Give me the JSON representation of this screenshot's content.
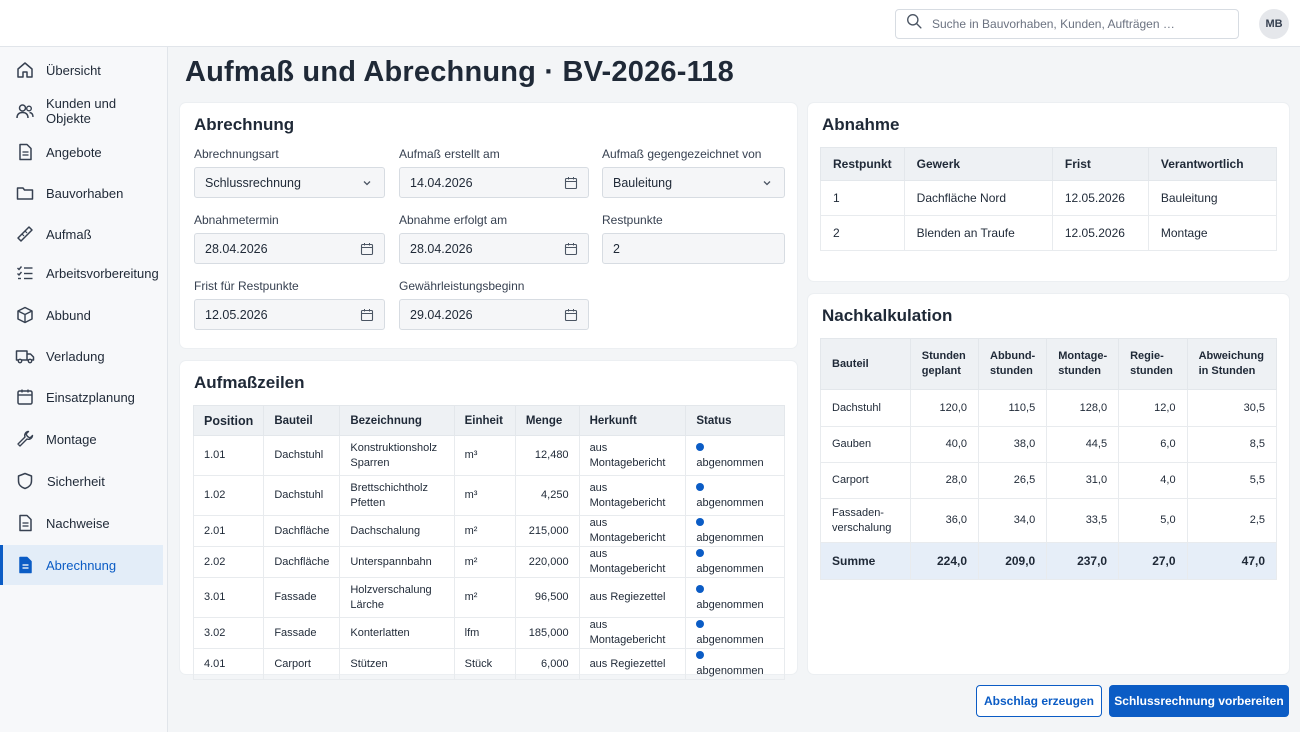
{
  "header": {
    "search_placeholder": "Suche in Bauvorhaben, Kunden, Aufträgen …",
    "user_initials": "MB"
  },
  "sidebar": {
    "items": [
      {
        "label": "Übersicht",
        "icon": "home-icon"
      },
      {
        "label": "Kunden und Objekte",
        "icon": "users-icon"
      },
      {
        "label": "Angebote",
        "icon": "document-icon"
      },
      {
        "label": "Bauvorhaben",
        "icon": "folder-icon"
      },
      {
        "label": "Aufmaß",
        "icon": "ruler-icon"
      },
      {
        "label": "Arbeitsvorbereitung",
        "icon": "checklist-icon"
      },
      {
        "label": "Abbund",
        "icon": "box-icon"
      },
      {
        "label": "Verladung",
        "icon": "truck-icon"
      },
      {
        "label": "Einsatzplanung",
        "icon": "calendar-icon"
      },
      {
        "label": "Montage",
        "icon": "wrench-icon"
      },
      {
        "label": "Sicherheit",
        "icon": "shield-icon"
      },
      {
        "label": "Nachweise",
        "icon": "document-icon"
      },
      {
        "label": "Abrechnung",
        "icon": "invoice-icon",
        "active": true
      }
    ]
  },
  "page": {
    "title": "Aufmaß und Abrechnung · BV-2026-118"
  },
  "abrechnung": {
    "title": "Abrechnung",
    "fields": {
      "abrechnungsart": {
        "label": "Abrechnungsart",
        "value": "Schlussrechnung"
      },
      "aufmass_erstellt": {
        "label": "Aufmaß erstellt am",
        "value": "14.04.2026"
      },
      "gegengezeichnet": {
        "label": "Aufmaß gegengezeichnet von",
        "value": "Bauleitung"
      },
      "abnahmetermin": {
        "label": "Abnahmetermin",
        "value": "28.04.2026"
      },
      "abnahme_erfolgt": {
        "label": "Abnahme erfolgt am",
        "value": "28.04.2026"
      },
      "restpunkte": {
        "label": "Restpunkte",
        "value": "2"
      },
      "frist": {
        "label": "Frist für Restpunkte",
        "value": "12.05.2026"
      },
      "gewaehrleistung": {
        "label": "Gewährleistungsbeginn",
        "value": "29.04.2026"
      }
    }
  },
  "abnahme": {
    "title": "Abnahme",
    "headers": [
      "Restpunkt",
      "Gewerk",
      "Frist",
      "Verantwortlich"
    ],
    "rows": [
      [
        "1",
        "Dachfläche Nord",
        "12.05.2026",
        "Bauleitung"
      ],
      [
        "2",
        "Blenden an Traufe",
        "12.05.2026",
        "Montage"
      ]
    ]
  },
  "aufmasszeilen": {
    "title": "Aufmaßzeilen",
    "headers": [
      "Position",
      "Bauteil",
      "Bezeichnung",
      "Einheit",
      "Menge",
      "Herkunft",
      "Status"
    ],
    "rows": [
      [
        "1.01",
        "Dachstuhl",
        "Konstruktionsholz Sparren",
        "m³",
        "12,480",
        "aus Montagebericht",
        "abgenommen"
      ],
      [
        "1.02",
        "Dachstuhl",
        "Brettschichtholz Pfetten",
        "m³",
        "4,250",
        "aus Montagebericht",
        "abgenommen"
      ],
      [
        "2.01",
        "Dachfläche",
        "Dachschalung",
        "m²",
        "215,000",
        "aus Montagebericht",
        "abgenommen"
      ],
      [
        "2.02",
        "Dachfläche",
        "Unterspannbahn",
        "m²",
        "220,000",
        "aus Montagebericht",
        "abgenommen"
      ],
      [
        "3.01",
        "Fassade",
        "Holzverschalung Lärche",
        "m²",
        "96,500",
        "aus Regiezettel",
        "abgenommen"
      ],
      [
        "3.02",
        "Fassade",
        "Konterlatten",
        "lfm",
        "185,000",
        "aus Montagebericht",
        "abgenommen"
      ],
      [
        "4.01",
        "Carport",
        "Stützen",
        "Stück",
        "6,000",
        "aus Regiezettel",
        "abgenommen"
      ]
    ]
  },
  "nachkalkulation": {
    "title": "Nachkalkulation",
    "headers": [
      "Bauteil",
      "Stunden geplant",
      "Abbund-stunden",
      "Montage-stunden",
      "Regie-stunden",
      "Abweichung in Stunden"
    ],
    "rows": [
      [
        "Dachstuhl",
        "120,0",
        "110,5",
        "128,0",
        "12,0",
        "30,5"
      ],
      [
        "Gauben",
        "40,0",
        "38,0",
        "44,5",
        "6,0",
        "8,5"
      ],
      [
        "Carport",
        "28,0",
        "26,5",
        "31,0",
        "4,0",
        "5,5"
      ],
      [
        "Fassaden-verschalung",
        "36,0",
        "34,0",
        "33,5",
        "5,0",
        "2,5"
      ]
    ],
    "sum_row": [
      "Summe",
      "224,0",
      "209,0",
      "237,0",
      "27,0",
      "47,0"
    ]
  },
  "actions": {
    "abschlag_label": "Abschlag erzeugen",
    "schluss_label": "Schlussrechnung vorbereiten"
  },
  "colors": {
    "accent": "#0b5cc5",
    "active_nav_bg": "#e3edf8",
    "sum_row_bg": "#e6eef8"
  }
}
